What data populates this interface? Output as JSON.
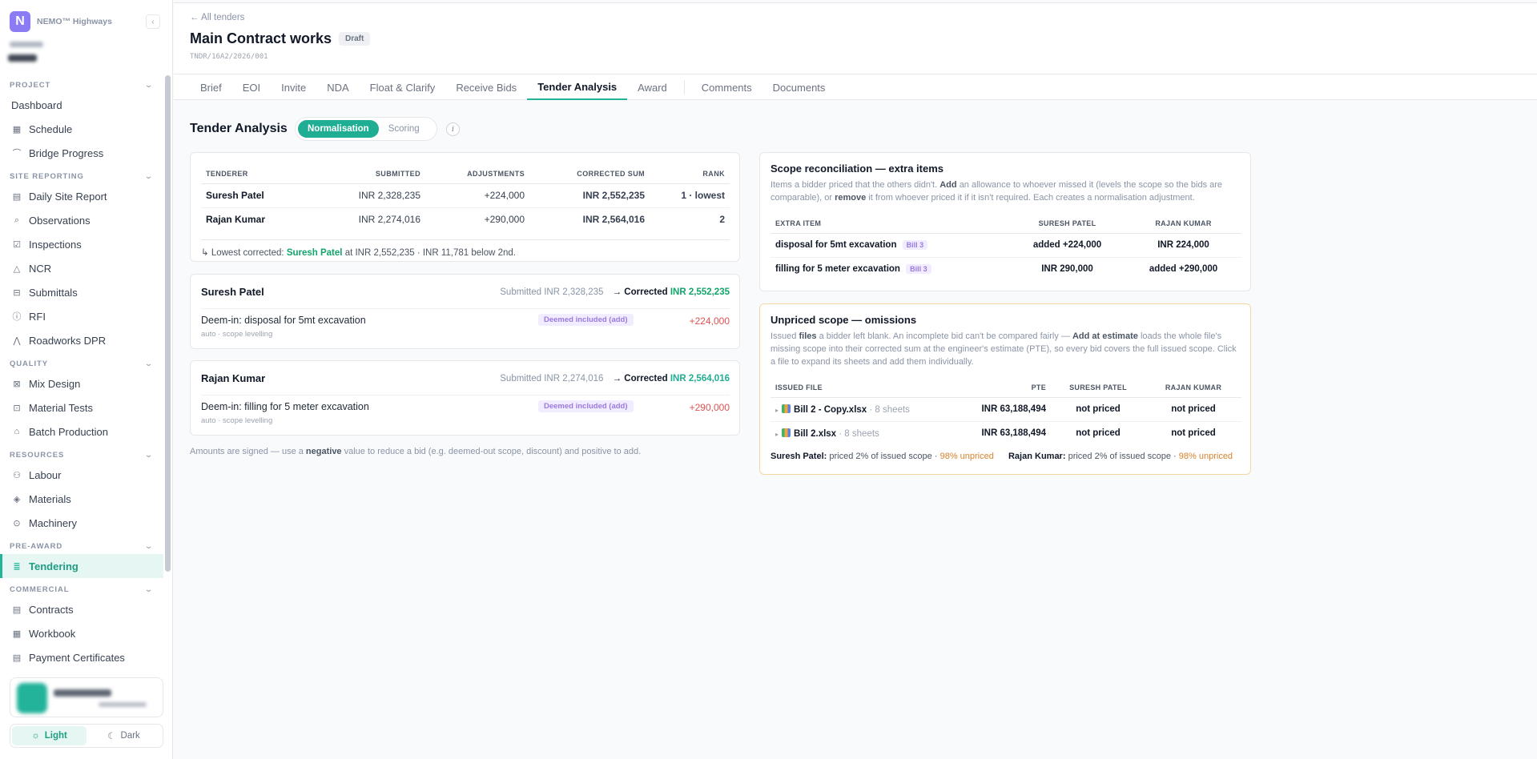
{
  "app": {
    "logo_letter": "N",
    "name": "NEMO™ Highways",
    "collapse_glyph": "‹"
  },
  "sidebar": {
    "sections": [
      {
        "title": "PROJECT",
        "items": [
          {
            "label": "Dashboard",
            "icon": ""
          },
          {
            "label": "Schedule",
            "icon": "calendar-icon"
          },
          {
            "label": "Bridge Progress",
            "icon": "bridge-icon"
          }
        ]
      },
      {
        "title": "SITE REPORTING",
        "items": [
          {
            "label": "Daily Site Report",
            "icon": "document-icon"
          },
          {
            "label": "Observations",
            "icon": "magnifier-icon"
          },
          {
            "label": "Inspections",
            "icon": "checklist-icon"
          },
          {
            "label": "NCR",
            "icon": "warning-icon"
          },
          {
            "label": "Submittals",
            "icon": "inbox-icon"
          },
          {
            "label": "RFI",
            "icon": "info-circle-icon"
          },
          {
            "label": "Roadworks DPR",
            "icon": "road-icon"
          }
        ]
      },
      {
        "title": "QUALITY",
        "items": [
          {
            "label": "Mix Design",
            "icon": "mix-icon"
          },
          {
            "label": "Material Tests",
            "icon": "test-icon"
          },
          {
            "label": "Batch Production",
            "icon": "factory-icon"
          }
        ]
      },
      {
        "title": "RESOURCES",
        "items": [
          {
            "label": "Labour",
            "icon": "people-icon"
          },
          {
            "label": "Materials",
            "icon": "box-icon"
          },
          {
            "label": "Machinery",
            "icon": "machine-icon"
          }
        ]
      },
      {
        "title": "PRE-AWARD",
        "items": [
          {
            "label": "Tendering",
            "icon": "list-icon",
            "active": true
          }
        ]
      },
      {
        "title": "COMMERCIAL",
        "items": [
          {
            "label": "Contracts",
            "icon": "document-icon"
          },
          {
            "label": "Workbook",
            "icon": "table-icon"
          },
          {
            "label": "Payment Certificates",
            "icon": "document-icon"
          }
        ]
      }
    ]
  },
  "theme": {
    "light_label": "Light",
    "dark_label": "Dark",
    "active": "light"
  },
  "header": {
    "back_link": "← All tenders",
    "title": "Main Contract works",
    "status": "Draft",
    "tender_id": "TNDR/16A2/2026/001"
  },
  "tabs": [
    {
      "label": "Brief"
    },
    {
      "label": "EOI"
    },
    {
      "label": "Invite"
    },
    {
      "label": "NDA"
    },
    {
      "label": "Float & Clarify"
    },
    {
      "label": "Receive Bids"
    },
    {
      "label": "Tender Analysis",
      "active": true
    },
    {
      "label": "Award"
    },
    {
      "label": "Comments",
      "group": 2
    },
    {
      "label": "Documents",
      "group": 2
    }
  ],
  "analysis": {
    "title": "Tender Analysis",
    "mode_normalisation": "Normalisation",
    "mode_scoring": "Scoring",
    "info_glyph": "i",
    "summary": {
      "columns": [
        "TENDERER",
        "SUBMITTED",
        "ADJUSTMENTS",
        "CORRECTED SUM",
        "RANK"
      ],
      "rows": [
        {
          "name": "Suresh Patel",
          "submitted": "INR 2,328,235",
          "adjustment": "+224,000",
          "corrected": "INR 2,552,235",
          "rank": "1 · lowest"
        },
        {
          "name": "Rajan Kumar",
          "submitted": "INR 2,274,016",
          "adjustment": "+290,000",
          "corrected": "INR 2,564,016",
          "rank": "2"
        }
      ],
      "lowest_prefix": "↳ Lowest corrected:",
      "lowest_name": "Suresh Patel",
      "lowest_suffix": "at INR 2,552,235 · INR 11,781 below 2nd."
    },
    "bidders": [
      {
        "name": "Suresh Patel",
        "submitted": "Submitted INR 2,328,235",
        "corrected_label": "→ Corrected",
        "corrected": "INR 2,552,235",
        "adj_desc": "Deem-in: disposal for 5mt excavation",
        "adj_meta": "auto · scope levelling",
        "adj_tag": "Deemed included (add)",
        "adj_amount": "+224,000"
      },
      {
        "name": "Rajan Kumar",
        "submitted": "Submitted INR 2,274,016",
        "corrected_label": "→ Corrected",
        "corrected": "INR 2,564,016",
        "adj_desc": "Deem-in: filling for 5 meter excavation",
        "adj_meta": "auto · scope levelling",
        "adj_tag": "Deemed included (add)",
        "adj_amount": "+290,000"
      }
    ],
    "footnote_pre": "Amounts are signed — use a",
    "footnote_bold": "negative",
    "footnote_post": "value to reduce a bid (e.g. deemed-out scope, discount) and positive to add."
  },
  "scope": {
    "title": "Scope reconciliation — extra items",
    "desc_1": "Items a bidder priced that the others didn't.",
    "desc_add": "Add",
    "desc_2": "an allowance to whoever missed it (levels the scope so the bids are comparable), or",
    "desc_remove": "remove",
    "desc_3": "it from whoever priced it if it isn't required. Each creates a normalisation adjustment.",
    "columns": [
      "EXTRA ITEM",
      "SURESH PATEL",
      "RAJAN KUMAR"
    ],
    "rows": [
      {
        "item": "disposal for 5mt excavation",
        "tag": "Bill 3",
        "suresh": "added +224,000",
        "rajan": "INR 224,000"
      },
      {
        "item": "filling for 5 meter excavation",
        "tag": "Bill 3",
        "suresh": "INR 290,000",
        "rajan": "added +290,000"
      }
    ]
  },
  "unpriced": {
    "title": "Unpriced scope — omissions",
    "desc_1": "Issued",
    "desc_files": "files",
    "desc_2": "a bidder left blank. An incomplete bid can't be compared fairly —",
    "desc_add": "Add at estimate",
    "desc_3": "loads the whole file's missing scope into their corrected sum at the engineer's estimate (PTE), so every bid covers the full issued scope. Click a file to expand its sheets and add them individually.",
    "columns": [
      "ISSUED FILE",
      "PTE",
      "SURESH PATEL",
      "RAJAN KUMAR"
    ],
    "caret": "▸",
    "rows": [
      {
        "file": "Bill 2 - Copy.xlsx",
        "sheets": "· 8 sheets",
        "pte": "INR 63,188,494",
        "suresh": "not priced",
        "rajan": "not priced"
      },
      {
        "file": "Bill 2.xlsx",
        "sheets": "· 8 sheets",
        "pte": "INR 63,188,494",
        "suresh": "not priced",
        "rajan": "not priced"
      }
    ],
    "coverage": [
      {
        "name": "Suresh Patel:",
        "text": "priced 2% of issued scope ·",
        "unpriced": "98% unpriced"
      },
      {
        "name": "Rajan Kumar:",
        "text": "priced 2% of issued scope ·",
        "unpriced": "98% unpriced"
      }
    ]
  }
}
